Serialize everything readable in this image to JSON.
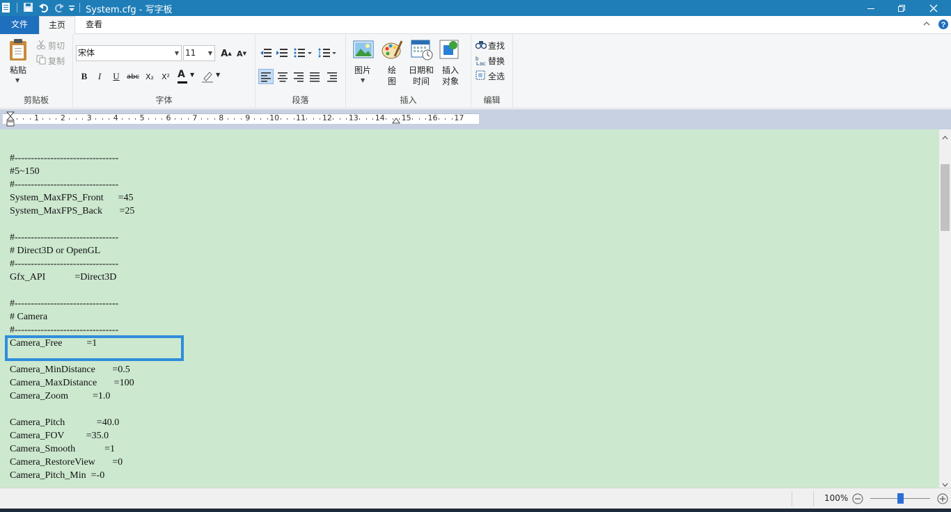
{
  "title_bar": {
    "title": "System.cfg - 写字板"
  },
  "tabs": {
    "file": "文件",
    "home": "主页",
    "view": "查看"
  },
  "ribbon": {
    "clipboard": {
      "paste": "粘贴",
      "cut": "剪切",
      "copy": "复制",
      "group": "剪贴板"
    },
    "font": {
      "font_name": "宋体",
      "font_size": "11",
      "group": "字体",
      "bold": "B",
      "italic": "I",
      "underline": "U",
      "strike": "abc",
      "sub": "X₂",
      "sup": "X²",
      "color_letter": "A",
      "grow": "A",
      "shrink": "A"
    },
    "paragraph": {
      "group": "段落"
    },
    "insert": {
      "picture": "图片",
      "paint_1": "绘",
      "paint_2": "图",
      "datetime_1": "日期和",
      "datetime_2": "时间",
      "object_1": "插入",
      "object_2": "对象",
      "group": "插入"
    },
    "edit": {
      "find": "查找",
      "replace": "替换",
      "select_all": "全选",
      "group": "编辑"
    }
  },
  "ruler": {
    "marks": [
      "1",
      "2",
      "3",
      "4",
      "5",
      "6",
      "7",
      "8",
      "9",
      "10",
      "11",
      "12",
      "13",
      "14",
      "15",
      "16",
      "17"
    ]
  },
  "document": {
    "lines": [
      "#--------------------------------",
      "#5~150",
      "#--------------------------------",
      "System_MaxFPS_Front      =45",
      "System_MaxFPS_Back       =25",
      "",
      "#--------------------------------",
      "# Direct3D or OpenGL",
      "#--------------------------------",
      "Gfx_API            =Direct3D",
      "",
      "#--------------------------------",
      "# Camera",
      "#--------------------------------",
      "Camera_Free          =1",
      "",
      "Camera_MinDistance       =0.5",
      "Camera_MaxDistance       =100",
      "Camera_Zoom          =1.0",
      "",
      "Camera_Pitch             =40.0",
      "Camera_FOV         =35.0",
      "Camera_Smooth            =1",
      "Camera_RestoreView       =0",
      "Camera_Pitch_Min  =-0"
    ]
  },
  "status": {
    "zoom": "100%",
    "zoom_level_percent": 100
  },
  "colors": {
    "accent": "#1f7eb8",
    "doc_bg": "#cce8cf",
    "highlight": "#2f8ddb"
  }
}
